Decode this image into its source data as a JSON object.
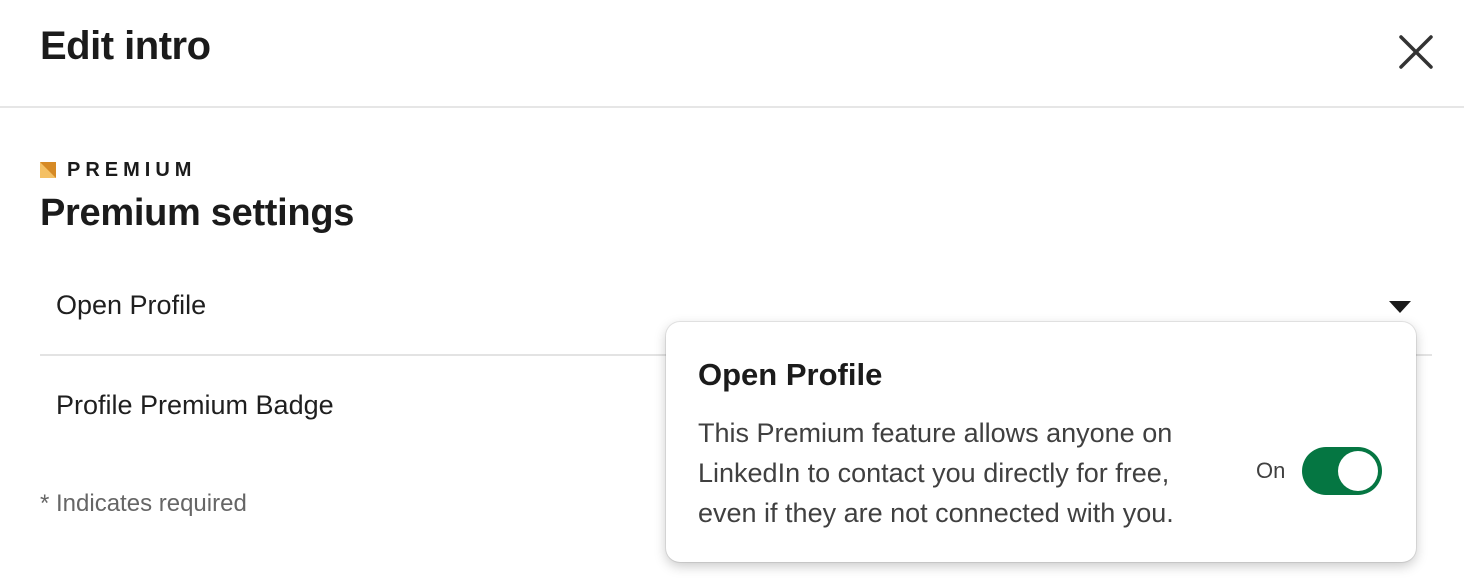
{
  "header": {
    "title": "Edit intro",
    "close_icon": "close-icon"
  },
  "premium": {
    "logo_icon": "premium-logo-icon",
    "logo_color": "#E7A33E",
    "label": "PREMIUM",
    "section_title": "Premium settings"
  },
  "settings": {
    "items": [
      {
        "label": "Open Profile",
        "icon": "caret-down-icon",
        "expanded": true
      },
      {
        "label": "Profile Premium Badge"
      }
    ]
  },
  "footer": {
    "required_note": "* Indicates required"
  },
  "popover": {
    "title": "Open Profile",
    "description": "This Premium feature allows anyone on LinkedIn to contact you directly for free, even if they are not connected with you.",
    "toggle": {
      "label": "On",
      "state": true,
      "color": "#057642"
    }
  }
}
